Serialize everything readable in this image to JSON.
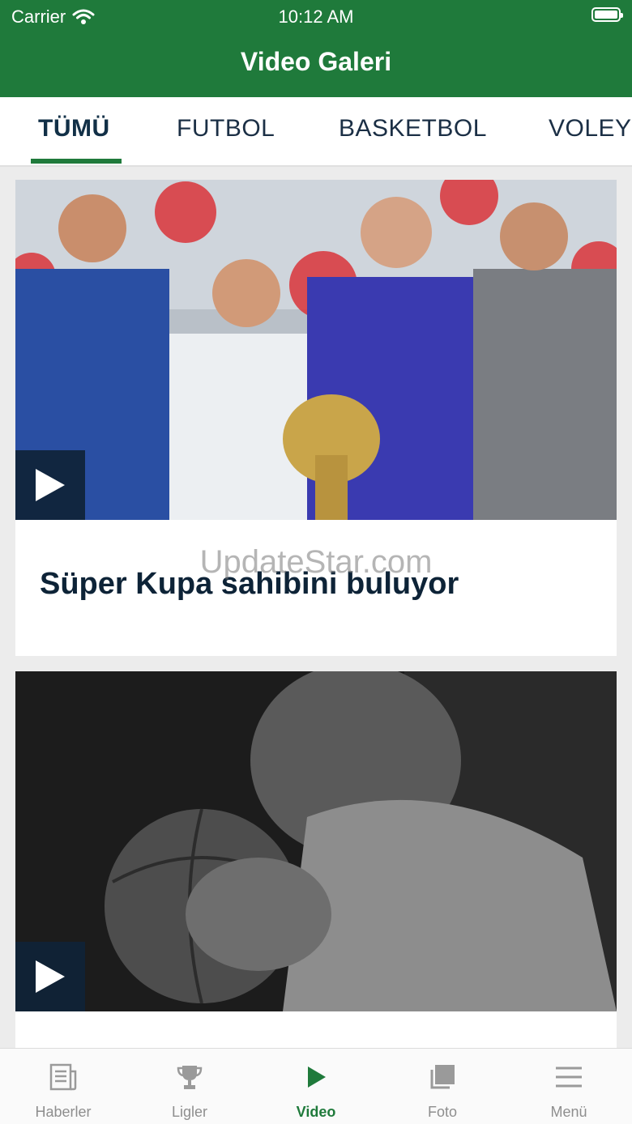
{
  "status": {
    "carrier": "Carrier",
    "time": "10:12 AM"
  },
  "header": {
    "title": "Video Galeri"
  },
  "tabs": [
    {
      "label": "TÜMÜ",
      "active": true
    },
    {
      "label": "FUTBOL"
    },
    {
      "label": "BASKETBOL"
    },
    {
      "label": "VOLEYBOL"
    }
  ],
  "videos": [
    {
      "title": "Süper Kupa sahibini buluyor"
    },
    {
      "title": ""
    }
  ],
  "watermark": "UpdateStar.com",
  "tabbar": [
    {
      "label": "Haberler",
      "icon": "news-icon"
    },
    {
      "label": "Ligler",
      "icon": "trophy-icon"
    },
    {
      "label": "Video",
      "icon": "play-icon",
      "active": true
    },
    {
      "label": "Foto",
      "icon": "photo-icon"
    },
    {
      "label": "Menü",
      "icon": "menu-icon"
    }
  ],
  "colors": {
    "brand": "#1f7a3b",
    "navy": "#0d2337"
  }
}
